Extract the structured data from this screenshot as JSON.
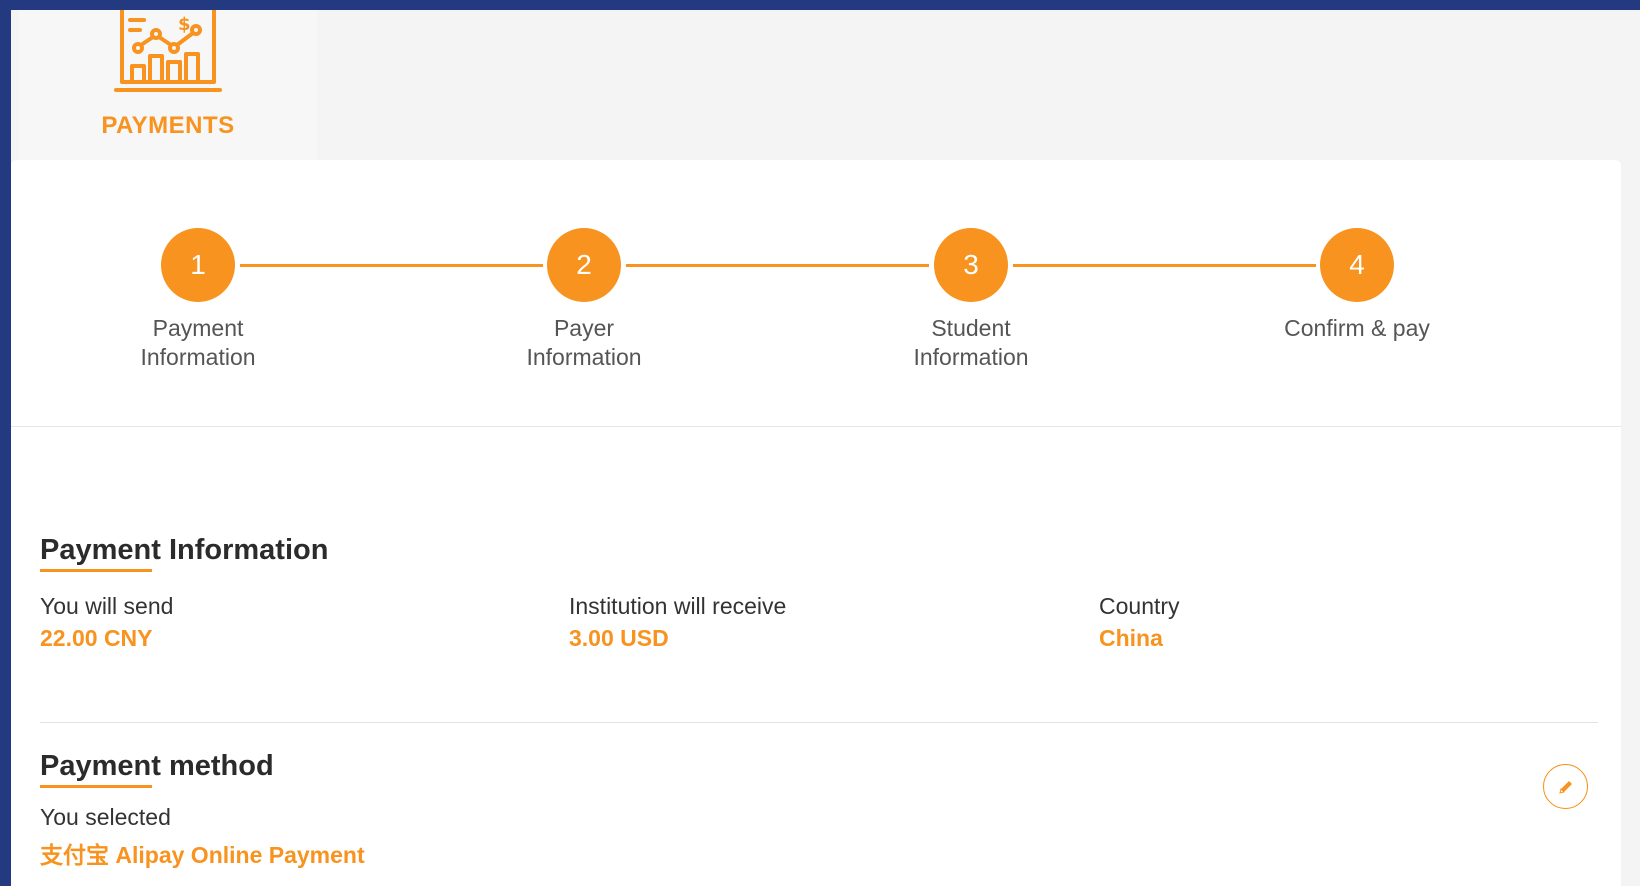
{
  "nav": {
    "tab_label": "PAYMENTS",
    "tab_icon": "payments-chart-icon"
  },
  "steps": [
    {
      "number": "1",
      "label": "Payment\nInformation"
    },
    {
      "number": "2",
      "label": "Payer\nInformation"
    },
    {
      "number": "3",
      "label": "Student\nInformation"
    },
    {
      "number": "4",
      "label": "Confirm & pay"
    }
  ],
  "payment_information": {
    "title": "Payment Information",
    "send_label": "You will send",
    "send_value": "22.00 CNY",
    "receive_label": "Institution will receive",
    "receive_value": "3.00 USD",
    "country_label": "Country",
    "country_value": "China"
  },
  "payment_method": {
    "title": "Payment method",
    "selected_label": "You selected",
    "selected_value": "支付宝 Alipay Online Payment",
    "edit_icon": "pencil-icon"
  },
  "colors": {
    "accent": "#f7931e",
    "frame": "#243a80",
    "background": "#f4f4f4"
  }
}
